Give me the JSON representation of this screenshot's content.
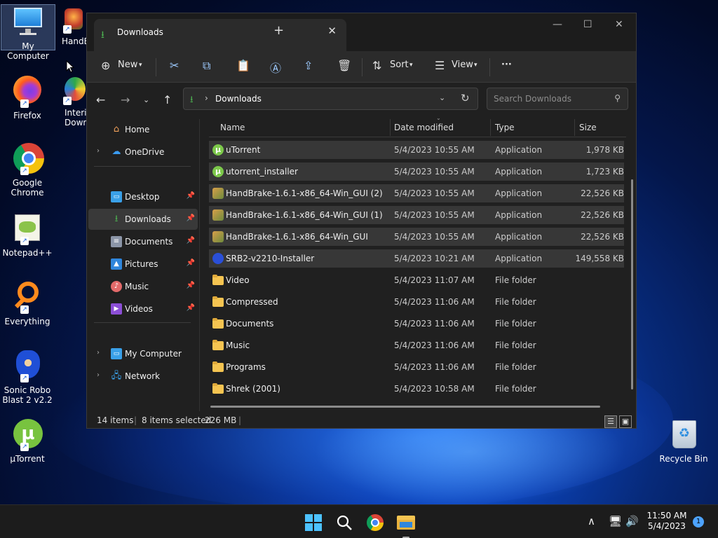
{
  "desktop": {
    "icons": [
      {
        "label": "My Computer",
        "icon": "monitor-icon"
      },
      {
        "label": "HandB",
        "icon": "handbrake-icon"
      },
      {
        "label": "Firefox",
        "icon": "firefox-icon"
      },
      {
        "label": "Interi\nDown",
        "icon": "internet-download-icon"
      },
      {
        "label": "Google\nChrome",
        "icon": "chrome-icon"
      },
      {
        "label": "Notepad++",
        "icon": "notepadpp-icon"
      },
      {
        "label": "Everything",
        "icon": "everything-icon"
      },
      {
        "label": "Sonic Robo\nBlast 2 v2.2",
        "icon": "sonic-icon"
      },
      {
        "label": "µTorrent",
        "icon": "utorrent-icon"
      },
      {
        "label": "Recycle Bin",
        "icon": "recycle-bin-icon"
      }
    ]
  },
  "window": {
    "tab_title": "Downloads",
    "toolbar": {
      "new_label": "New",
      "sort_label": "Sort",
      "view_label": "View",
      "more": "···"
    },
    "address": {
      "path": "Downloads",
      "search_placeholder": "Search Downloads"
    },
    "nav": [
      {
        "label": "Home"
      },
      {
        "label": "OneDrive"
      },
      {
        "label": "Desktop"
      },
      {
        "label": "Downloads"
      },
      {
        "label": "Documents"
      },
      {
        "label": "Pictures"
      },
      {
        "label": "Music"
      },
      {
        "label": "Videos"
      },
      {
        "label": "My Computer"
      },
      {
        "label": "Network"
      }
    ],
    "columns": {
      "name": "Name",
      "date": "Date modified",
      "type": "Type",
      "size": "Size"
    },
    "files": [
      {
        "name": "uTorrent",
        "date": "5/4/2023 10:55 AM",
        "type": "Application",
        "size": "1,978 KB",
        "icon": "utorrent-icon",
        "selected": true
      },
      {
        "name": "utorrent_installer",
        "date": "5/4/2023 10:55 AM",
        "type": "Application",
        "size": "1,723 KB",
        "icon": "utorrent-icon",
        "selected": true
      },
      {
        "name": "HandBrake-1.6.1-x86_64-Win_GUI (2)",
        "date": "5/4/2023 10:55 AM",
        "type": "Application",
        "size": "22,526 KB",
        "icon": "handbrake-icon",
        "selected": true
      },
      {
        "name": "HandBrake-1.6.1-x86_64-Win_GUI (1)",
        "date": "5/4/2023 10:55 AM",
        "type": "Application",
        "size": "22,526 KB",
        "icon": "handbrake-icon",
        "selected": true
      },
      {
        "name": "HandBrake-1.6.1-x86_64-Win_GUI",
        "date": "5/4/2023 10:55 AM",
        "type": "Application",
        "size": "22,526 KB",
        "icon": "handbrake-icon",
        "selected": true
      },
      {
        "name": "SRB2-v2210-Installer",
        "date": "5/4/2023 10:21 AM",
        "type": "Application",
        "size": "149,558 KB",
        "icon": "sonic-icon",
        "selected": true
      },
      {
        "name": "Video",
        "date": "5/4/2023 11:07 AM",
        "type": "File folder",
        "size": "",
        "icon": "folder-icon",
        "selected": false
      },
      {
        "name": "Compressed",
        "date": "5/4/2023 11:06 AM",
        "type": "File folder",
        "size": "",
        "icon": "folder-icon",
        "selected": false
      },
      {
        "name": "Documents",
        "date": "5/4/2023 11:06 AM",
        "type": "File folder",
        "size": "",
        "icon": "folder-icon",
        "selected": false
      },
      {
        "name": "Music",
        "date": "5/4/2023 11:06 AM",
        "type": "File folder",
        "size": "",
        "icon": "folder-icon",
        "selected": false
      },
      {
        "name": "Programs",
        "date": "5/4/2023 11:06 AM",
        "type": "File folder",
        "size": "",
        "icon": "folder-icon",
        "selected": false
      },
      {
        "name": "Shrek (2001)",
        "date": "5/4/2023 10:58 AM",
        "type": "File folder",
        "size": "",
        "icon": "folder-icon",
        "selected": false
      }
    ],
    "status": {
      "items": "14 items",
      "selected": "8 items selected",
      "size": "226 MB"
    }
  },
  "taskbar": {
    "time": "11:50 AM",
    "date": "5/4/2023",
    "notification_count": "1"
  },
  "colors": {
    "accent": "#4da3ff",
    "folder": "#f5c451",
    "download_green": "#4caf50"
  }
}
